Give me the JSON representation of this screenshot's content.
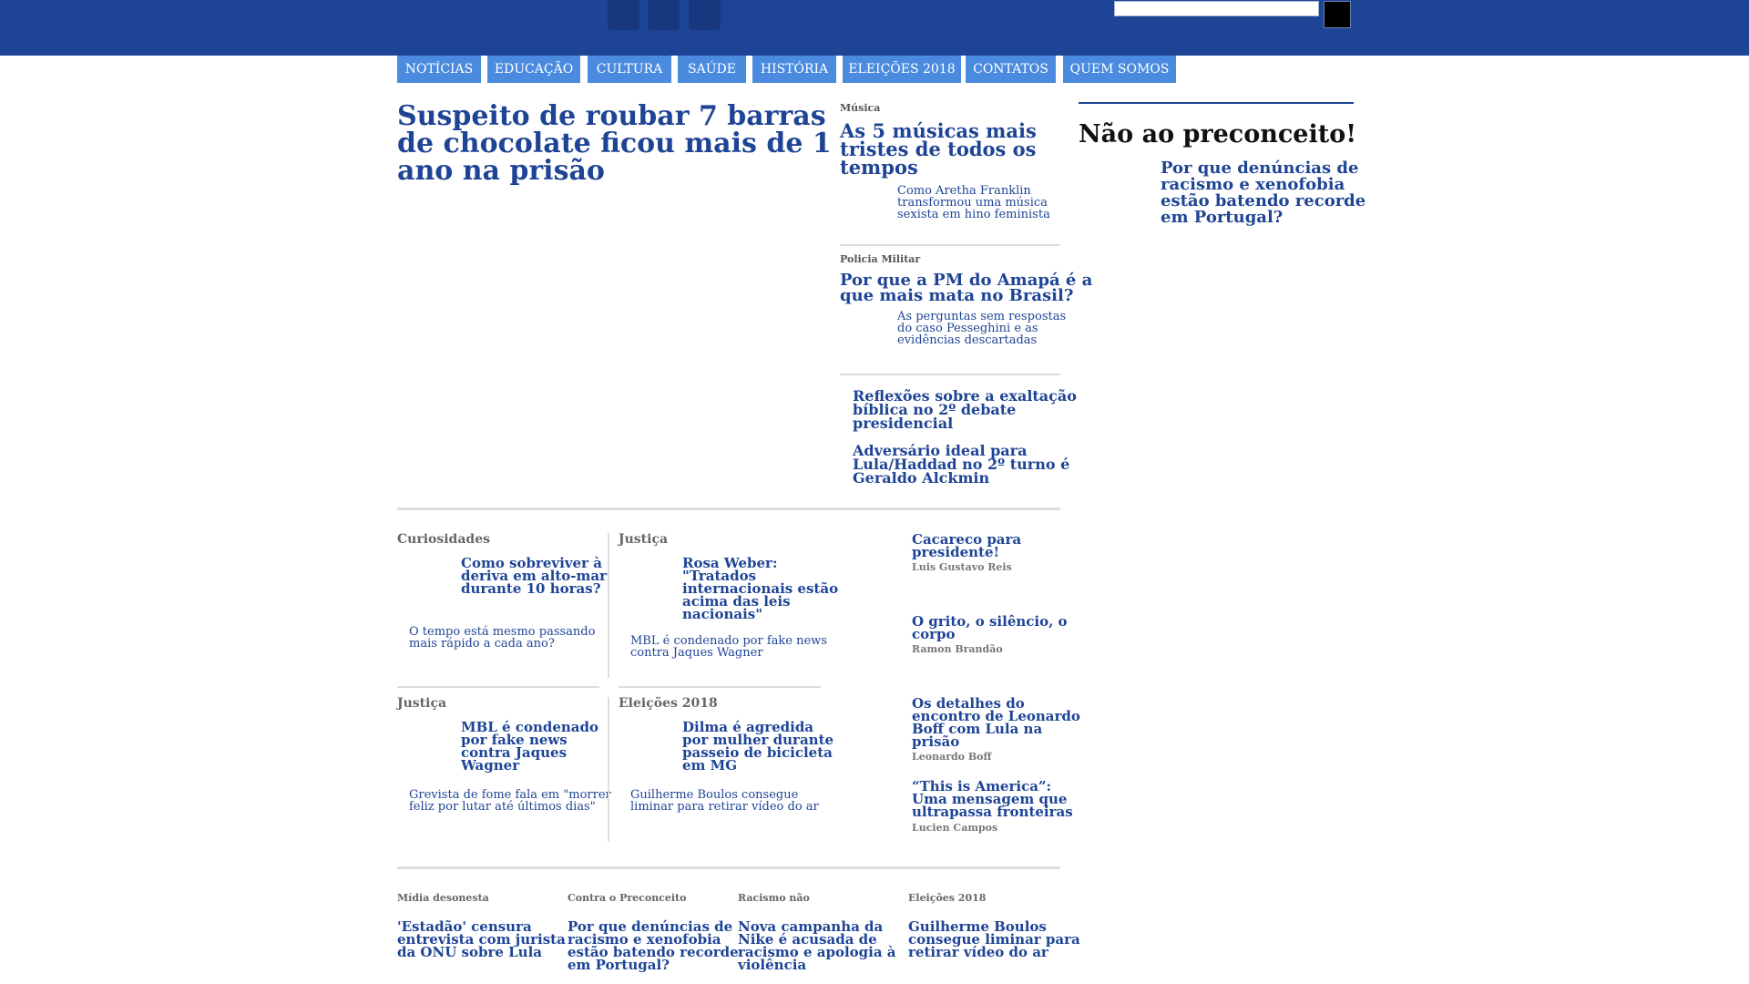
{
  "nav": [
    "NOTÍCIAS",
    "EDUCAÇÃO",
    "CULTURA",
    "SAÚDE",
    "HISTÓRIA",
    "ELEIÇÕES 2018",
    "CONTATOS",
    "QUEM SOMOS"
  ],
  "lead": {
    "title_lines": [
      "Suspeito de roubar 7 barras",
      "de chocolate ficou mais de 1",
      "ano na prisão"
    ]
  },
  "side": [
    {
      "category": "Música",
      "title_lines": [
        "As 5 músicas mais",
        "tristes de todos os",
        "tempos"
      ],
      "related_lines": [
        "Como Aretha Franklin",
        "transformou uma música",
        "sexista em hino feminista"
      ]
    },
    {
      "category": "Policia Militar",
      "title_lines": [
        "Por que a PM do Amapá é a",
        "que mais mata no Brasil?"
      ],
      "related_lines": [
        "As perguntas sem respostas",
        "do caso Pesseghini e as",
        "evidências descartadas"
      ]
    }
  ],
  "side_links": [
    {
      "lines": [
        "Reflexões sobre a exaltação",
        "bíblica no 2º debate",
        "presidencial"
      ]
    },
    {
      "lines": [
        "Adversário ideal para",
        "Lula/Haddad no 2º turno é",
        "Geraldo Alckmin"
      ]
    }
  ],
  "right": {
    "heading": "Não ao preconceito!",
    "link_lines": [
      "Por que denúncias de",
      "racismo e xenofobia",
      "estão batendo recorde",
      "em Portugal?"
    ]
  },
  "grid": [
    {
      "category": "Curiosidades",
      "title_lines": [
        "Como sobreviver à",
        "deriva em alto-mar",
        "durante 10 horas?"
      ],
      "related_lines": [
        "O tempo está mesmo passando",
        "mais rápido a cada ano?"
      ]
    },
    {
      "category": "Justiça",
      "title_lines": [
        "Rosa Weber:",
        "\"Tratados",
        "internacionais estão",
        "acima das leis",
        "nacionais\""
      ],
      "related_lines": [
        "MBL é condenado por fake news",
        "contra Jaques Wagner"
      ]
    },
    {
      "category": "Justiça",
      "title_lines": [
        "MBL é condenado",
        "por fake news",
        "contra Jaques",
        "Wagner"
      ],
      "related_lines": [
        "Grevista de fome fala em \"morrer",
        "feliz por lutar até últimos dias\""
      ]
    },
    {
      "category": "Eleições 2018",
      "title_lines": [
        "Dilma é agredida",
        "por mulher durante",
        "passeio de bicicleta",
        "em MG"
      ],
      "related_lines": [
        "Guilherme Boulos consegue",
        "liminar para retirar vídeo do ar"
      ]
    }
  ],
  "columns": [
    {
      "title_lines": [
        "Cacareco para",
        "presidente!"
      ],
      "author": "Luis Gustavo Reis"
    },
    {
      "title_lines": [
        "O grito, o silêncio, o",
        "corpo"
      ],
      "author": "Ramon Brandão"
    },
    {
      "title_lines": [
        "Os detalhes do",
        "encontro de Leonardo",
        "Boff com Lula na",
        "prisão"
      ],
      "author": "Leonardo Boff"
    },
    {
      "title_lines": [
        "“This is America”:",
        "Uma mensagem que",
        "ultrapassa fronteiras"
      ],
      "author": "Lucien Campos"
    }
  ],
  "bottom": [
    {
      "category": "Mídia desonesta",
      "title_lines": [
        "'Estadão' censura",
        "entrevista com jurista",
        "da ONU sobre Lula"
      ]
    },
    {
      "category": "Contra o Preconceito",
      "title_lines": [
        "Por que denúncias de",
        "racismo e xenofobia",
        "estão batendo recorde",
        "em Portugal?"
      ]
    },
    {
      "category": "Racismo não",
      "title_lines": [
        "Nova campanha da",
        "Nike é acusada de",
        "racismo e apologia à",
        "violência"
      ]
    },
    {
      "category": "Eleições 2018",
      "title_lines": [
        "Guilherme Boulos",
        "consegue liminar para",
        "retirar vídeo do ar"
      ]
    }
  ]
}
